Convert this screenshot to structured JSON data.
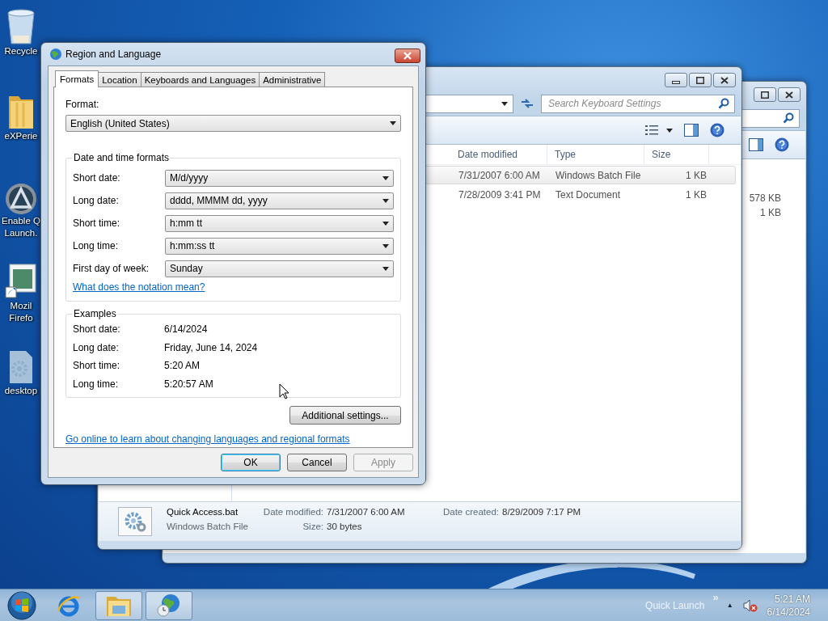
{
  "desktop_icons": [
    {
      "kind": "recycle-bin",
      "label_lines": [
        "Recycle"
      ]
    },
    {
      "kind": "folder",
      "label_lines": [
        "eXPerie"
      ]
    },
    {
      "kind": "app",
      "label_lines": [
        "Enable Q",
        "Launch."
      ]
    },
    {
      "kind": "shortcut",
      "label_lines": [
        "Mozil",
        "Firefo"
      ]
    },
    {
      "kind": "settings-file",
      "label_lines": [
        "desktop"
      ]
    }
  ],
  "back_window": {
    "size_cells": [
      "578 KB",
      "1 KB"
    ]
  },
  "explorer_window": {
    "search": {
      "placeholder": "Search Keyboard Settings"
    },
    "columns": [
      "Date modified",
      "Type",
      "Size"
    ],
    "rows": [
      {
        "date": "7/31/2007 6:00 AM",
        "type": "Windows Batch File",
        "size": "1 KB",
        "selected": true
      },
      {
        "date": "7/28/2009 3:41 PM",
        "type": "Text Document",
        "size": "1 KB",
        "selected": false
      }
    ],
    "details": {
      "name": "Quick Access.bat",
      "type": "Windows Batch File",
      "fields": [
        {
          "label": "Date modified:",
          "value": "7/31/2007 6:00 AM"
        },
        {
          "label": "Date created:",
          "value": "8/29/2009 7:17 PM"
        },
        {
          "label": "Size:",
          "value": "30 bytes"
        }
      ]
    }
  },
  "dialog": {
    "title": "Region and Language",
    "tabs": [
      {
        "label": "Formats",
        "selected": true
      },
      {
        "label": "Location",
        "selected": false
      },
      {
        "label": "Keyboards and Languages",
        "selected": false
      },
      {
        "label": "Administrative",
        "selected": false
      }
    ],
    "format_label": "Format:",
    "format_value": "English (United States)",
    "date_time_formats": {
      "title": "Date and time formats",
      "rows": [
        {
          "label": "Short date:",
          "value": "M/d/yyyy"
        },
        {
          "label": "Long date:",
          "value": "dddd, MMMM dd, yyyy"
        },
        {
          "label": "Short time:",
          "value": "h:mm tt"
        },
        {
          "label": "Long time:",
          "value": "h:mm:ss tt"
        },
        {
          "label": "First day of week:",
          "value": "Sunday"
        }
      ]
    },
    "notation_link": "What does the notation mean?",
    "examples": {
      "title": "Examples",
      "rows": [
        {
          "label": "Short date:",
          "value": "6/14/2024"
        },
        {
          "label": "Long date:",
          "value": "Friday, June 14, 2024"
        },
        {
          "label": "Short time:",
          "value": "5:20 AM"
        },
        {
          "label": "Long time:",
          "value": "5:20:57 AM"
        }
      ]
    },
    "additional_button": "Additional settings...",
    "online_link": "Go online to learn about changing languages and regional formats",
    "buttons": [
      {
        "label": "OK",
        "default": true,
        "disabled": false
      },
      {
        "label": "Cancel",
        "default": false,
        "disabled": false
      },
      {
        "label": "Apply",
        "default": false,
        "disabled": true
      }
    ]
  },
  "taskbar": {
    "items": [
      {
        "kind": "ie",
        "running": false
      },
      {
        "kind": "explorer",
        "running": true
      },
      {
        "kind": "globe",
        "running": true
      }
    ],
    "quick_launch": "Quick Launch",
    "chevron": "»",
    "tray_arrow": "▲",
    "time": "5:21 AM",
    "date": "6/14/2024"
  }
}
